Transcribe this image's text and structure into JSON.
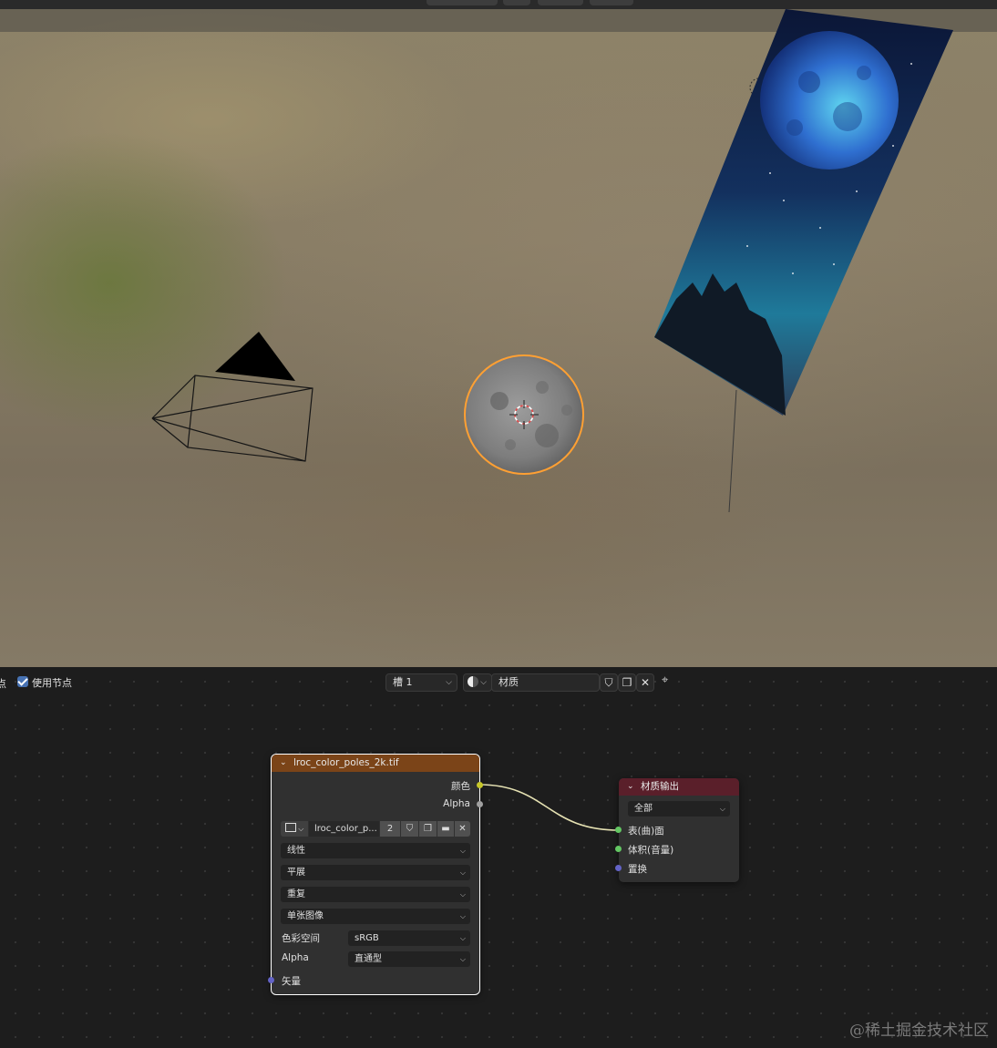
{
  "node_editor_header": {
    "use_nodes_label": "使用节点",
    "slot_label": "槽 1",
    "material_name": "材质"
  },
  "image_node": {
    "title": "lroc_color_poles_2k.tif",
    "outputs": [
      "颜色",
      "Alpha"
    ],
    "image_name": "lroc_color_p...",
    "users_count": "2",
    "interpolation": "线性",
    "projection": "平展",
    "extension": "重复",
    "source": "单张图像",
    "colorspace_label": "色彩空间",
    "colorspace_value": "sRGB",
    "alpha_label": "Alpha",
    "alpha_value": "直通型",
    "input_vector": "矢量"
  },
  "output_node": {
    "title": "材质输出",
    "target": "全部",
    "inputs": [
      "表(曲)面",
      "体积(音量)",
      "置换"
    ]
  },
  "watermark": "@稀土掘金技术社区",
  "colors": {
    "image_node_header": "#7b4418",
    "output_node_header": "#5a1f2a",
    "selection_outline": "#ffa033",
    "link": "#e6e2b3"
  }
}
